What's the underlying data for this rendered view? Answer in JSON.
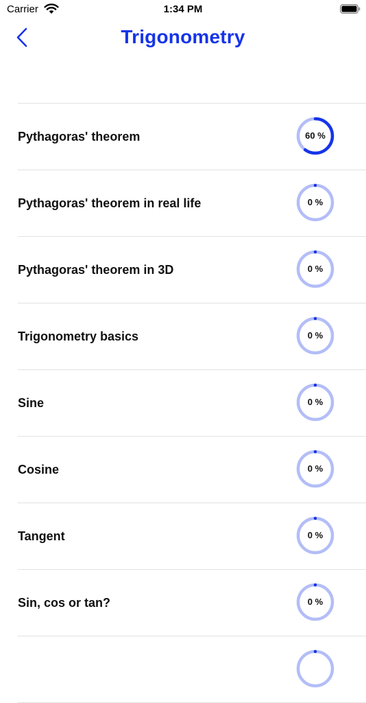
{
  "status_bar": {
    "carrier": "Carrier",
    "time": "1:34 PM"
  },
  "nav": {
    "title": "Trigonometry",
    "back_icon": "chevron-left-icon"
  },
  "colors": {
    "accent": "#1634e8",
    "ring_track": "#b3bdf7",
    "ring_fill": "#1634e8",
    "divider": "#e2e2e6"
  },
  "topics": [
    {
      "title": "Pythagoras' theorem",
      "progress_label": "60 %",
      "progress": 0.6
    },
    {
      "title": "Pythagoras' theorem in real life",
      "progress_label": "0 %",
      "progress": 0
    },
    {
      "title": "Pythagoras' theorem in 3D",
      "progress_label": "0 %",
      "progress": 0
    },
    {
      "title": "Trigonometry basics",
      "progress_label": "0 %",
      "progress": 0
    },
    {
      "title": "Sine",
      "progress_label": "0 %",
      "progress": 0
    },
    {
      "title": "Cosine",
      "progress_label": "0 %",
      "progress": 0
    },
    {
      "title": "Tangent",
      "progress_label": "0 %",
      "progress": 0
    },
    {
      "title": "Sin, cos or tan?",
      "progress_label": "0 %",
      "progress": 0
    },
    {
      "title": "",
      "progress_label": "",
      "progress": 0
    }
  ]
}
